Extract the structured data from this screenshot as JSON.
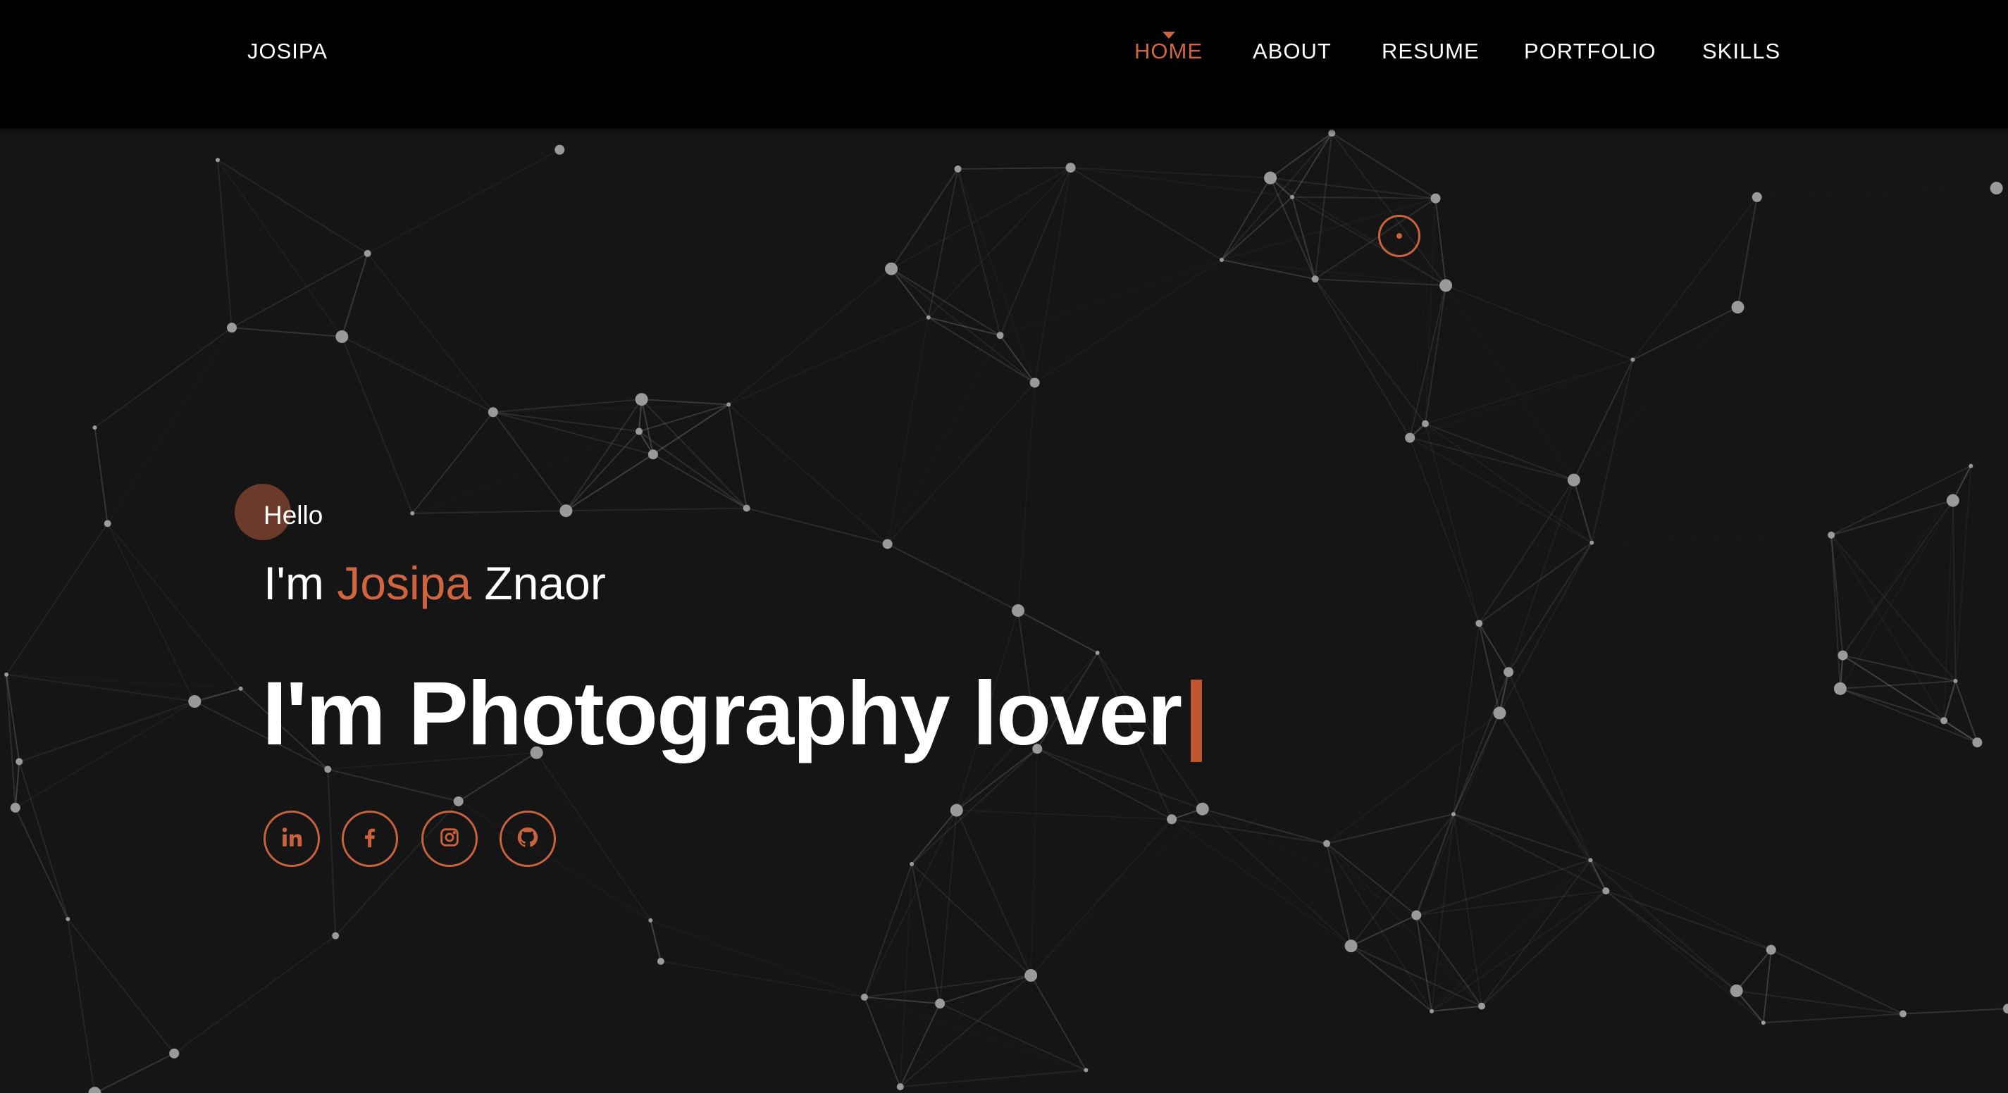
{
  "header": {
    "brand": "JOSIPA",
    "nav": [
      {
        "label": "HOME",
        "active": true
      },
      {
        "label": "ABOUT"
      },
      {
        "label": "RESUME"
      },
      {
        "label": "PORTFOLIO"
      },
      {
        "label": "SKILLS"
      }
    ]
  },
  "hero": {
    "greeting": "Hello",
    "intro_prefix": "I'm",
    "intro_first": "Josipa",
    "intro_last": "Znaor",
    "typed_text": "I'm Photography lover",
    "social": [
      {
        "icon": "linkedin-icon"
      },
      {
        "icon": "facebook-icon"
      },
      {
        "icon": "instagram-icon"
      },
      {
        "icon": "github-icon"
      }
    ]
  },
  "colors": {
    "accent": "#d0653f",
    "background": "#151515",
    "header": "#000000"
  }
}
